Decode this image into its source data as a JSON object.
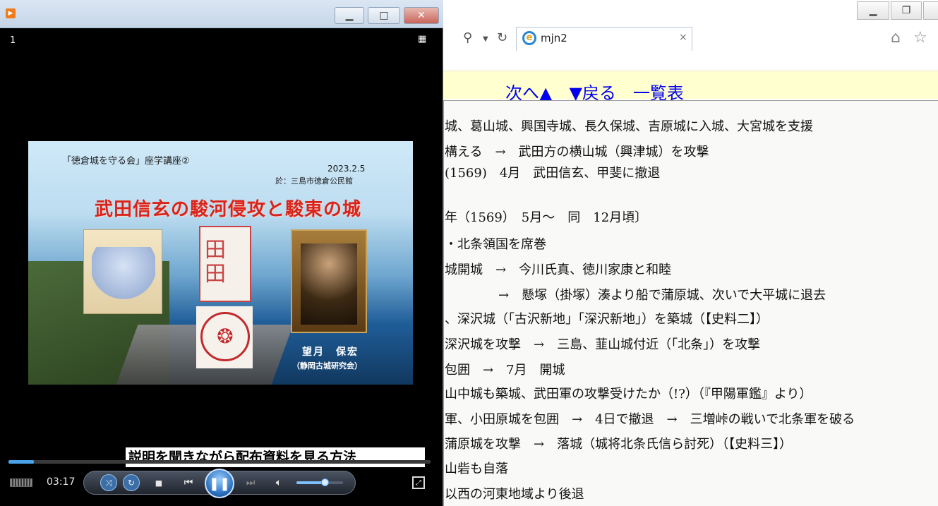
{
  "browser": {
    "tab_title": "mjn2",
    "tab_close": "×",
    "nav": {
      "next": "次へ▲",
      "back": "▼戻る",
      "list": "一覧表"
    },
    "doc_lines": [
      "城、葛山城、興国寺城、長久保城、吉原城に入城、大宮城を支援",
      "構える　→　武田方の横山城（興津城）を攻撃",
      "(1569)　4月　武田信玄、甲斐に撤退",
      "年（1569）　5月～　同　12月頃〕",
      "・北条領国を席巻",
      "城開城　→　今川氏真、徳川家康と和睦",
      "→　懸塚（掛塚）湊より船で蒲原城、次いで大平城に退去",
      "、深沢城（「古沢新地」「深沢新地」）を築城（【史料二】）",
      "深沢城を攻撃　→　三島、韮山城付近（「北条」）を攻撃",
      "包囲　→　7月　開城",
      "山中城も築城、武田軍の攻撃受けたか（!?）（『甲陽軍鑑』より）",
      "軍、小田原城を包囲　→　4日で撤退　→　三増峠の戦いで北条軍を破る",
      "蒲原城を攻撃　→　落城（城将北条氏信ら討死）（【史料三】）",
      "山砦も自落",
      "以西の河東地域より後退"
    ]
  },
  "player": {
    "track_number": "1",
    "slide": {
      "lecture": "「徳倉城を守る会」座学講座②",
      "date": "2023.2.5",
      "venue": "於：三島市徳倉公民館",
      "title": "武田信玄の駿河侵攻と駿東の城",
      "speaker": "望月　保宏",
      "affiliation": "（静岡古城研究会）"
    },
    "caption": "説明を聞きながら配布資料を見る方法",
    "time": "03:17",
    "seek_progress": 0.06,
    "volume_level": 0.6
  },
  "icons": {
    "search": "search-icon",
    "refresh": "refresh-icon",
    "home": "home-icon",
    "favorites": "star-icon",
    "play_pause": "pause-icon"
  },
  "colors": {
    "accent": "#2a6fc0",
    "link": "#0000ee",
    "nav_band": "#ffffd0",
    "slide_title": "#d8241b"
  }
}
